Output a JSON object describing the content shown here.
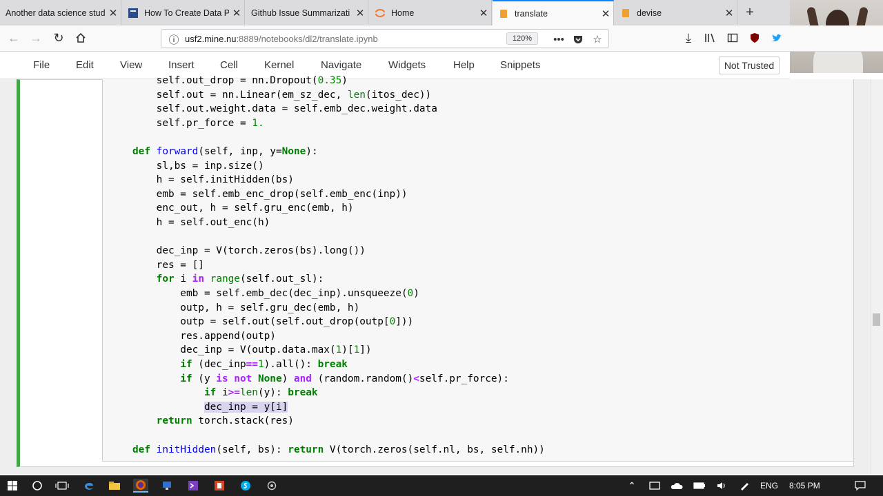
{
  "tabs": [
    {
      "title": "Another data science stud",
      "icon": "page-icon"
    },
    {
      "title": "How To Create Data P",
      "icon": "page-icon"
    },
    {
      "title": "Github Issue Summarizati",
      "icon": "page-icon"
    },
    {
      "title": "Home",
      "icon": "jupyter-icon"
    },
    {
      "title": "translate",
      "icon": "notebook-icon"
    },
    {
      "title": "devise",
      "icon": "notebook-icon"
    }
  ],
  "url": {
    "host": "usf2.mine.nu",
    "rest": ":8889/notebooks/dl2/translate.ipynb",
    "zoom": "120%"
  },
  "menu": [
    "File",
    "Edit",
    "View",
    "Insert",
    "Cell",
    "Kernel",
    "Navigate",
    "Widgets",
    "Help",
    "Snippets"
  ],
  "trusted": "Not Trusted",
  "code_lines": [
    "    self.out_drop = nn.Dropout(0.35)",
    "    self.out = nn.Linear(em_sz_dec, len(itos_dec))",
    "    self.out.weight.data = self.emb_dec.weight.data",
    "    self.pr_force = 1.",
    "",
    "def forward(self, inp, y=None):",
    "    sl,bs = inp.size()",
    "    h = self.initHidden(bs)",
    "    emb = self.emb_enc_drop(self.emb_enc(inp))",
    "    enc_out, h = self.gru_enc(emb, h)",
    "    h = self.out_enc(h)",
    "",
    "    dec_inp = V(torch.zeros(bs).long())",
    "    res = []",
    "    for i in range(self.out_sl):",
    "        emb = self.emb_dec(dec_inp).unsqueeze(0)",
    "        outp, h = self.gru_dec(emb, h)",
    "        outp = self.out(self.out_drop(outp[0]))",
    "        res.append(outp)",
    "        dec_inp = V(outp.data.max(1)[1])",
    "        if (dec_inp==1).all(): break",
    "        if (y is not None) and (random.random()<self.pr_force):",
    "            if i>=len(y): break",
    "            dec_inp = y[i]",
    "    return torch.stack(res)",
    "",
    "def initHidden(self, bs): return V(torch.zeros(self.nl, bs, self.nh))"
  ],
  "taskbar": {
    "language": "ENG",
    "time": "8:05 PM"
  }
}
